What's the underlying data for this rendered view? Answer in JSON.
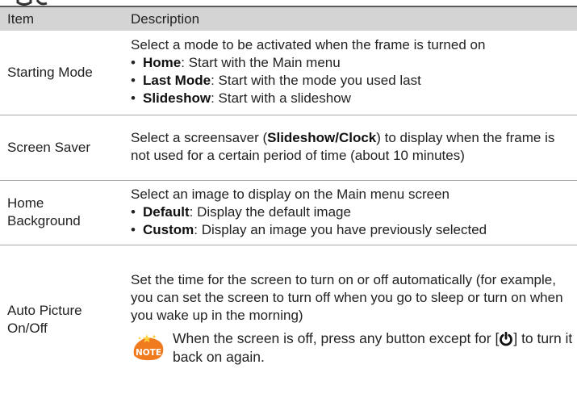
{
  "header": {
    "item": "Item",
    "description": "Description"
  },
  "rows": [
    {
      "item": "Starting Mode",
      "intro": "Select a mode to be activated when the frame is turned on",
      "bullets": [
        {
          "term": "Home",
          "text": ": Start with the Main menu"
        },
        {
          "term": "Last Mode",
          "text": ": Start with the mode you used last"
        },
        {
          "term": "Slideshow",
          "text": ": Start with a slideshow"
        }
      ]
    },
    {
      "item": "Screen Saver",
      "pre": "Select a screensaver (",
      "opt1": "Slideshow",
      "sep": "/",
      "opt2": "Clock",
      "post": ") to display when the frame is not used for a certain period of time (about 10 minutes)"
    },
    {
      "item_line1": "Home",
      "item_line2": "Background",
      "intro": "Select an image to display on the Main menu screen",
      "bullets": [
        {
          "term": "Default",
          "text": ": Display the default image"
        },
        {
          "term": "Custom",
          "text": ": Display an image you have previously selected"
        }
      ]
    },
    {
      "item_line1": "Auto Picture",
      "item_line2": "On/Off",
      "intro": "Set the time for the screen to turn on or off automatically (for example, you can set the screen to turn off when you go to sleep or turn on when you wake up in the morning)",
      "note_label": "NOTE",
      "note_pre": "When the screen is off, press any button except for [",
      "note_post": "] to turn it back on again."
    }
  ],
  "colors": {
    "header_bg": "#d4d4d4",
    "note_orange": "#f07a1e",
    "rule": "#a8a8a8"
  },
  "icons": {
    "note": "note-badge-icon",
    "power": "power-icon"
  },
  "bullet_char": "•"
}
